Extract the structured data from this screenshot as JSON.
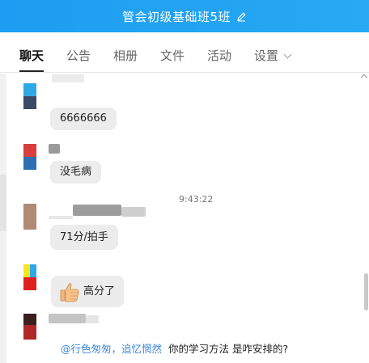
{
  "window": {
    "title": "管会初级基础班5班"
  },
  "tabs": [
    {
      "label": "聊天",
      "active": true
    },
    {
      "label": "公告",
      "active": false
    },
    {
      "label": "相册",
      "active": false
    },
    {
      "label": "文件",
      "active": false
    },
    {
      "label": "活动",
      "active": false
    },
    {
      "label": "设置",
      "active": false
    }
  ],
  "chat": {
    "timestamp": "9:43:22",
    "messages": [
      {
        "text": "6666666"
      },
      {
        "text": "没毛病"
      },
      {
        "text": "71分/拍手"
      },
      {
        "text": "高分了",
        "emoji": "thumbs-up"
      },
      {
        "mention": "@行色匆匆，追忆惘然",
        "text": "你的学习方法  是咋安排的?"
      }
    ]
  },
  "colors": {
    "titlebar": "#1d9df1",
    "bubble": "#ececec",
    "mention": "#3a86d8"
  },
  "icons": [
    "edit-icon",
    "chevron-down-icon",
    "thumbs-up-icon",
    "scroll-up-icon"
  ]
}
